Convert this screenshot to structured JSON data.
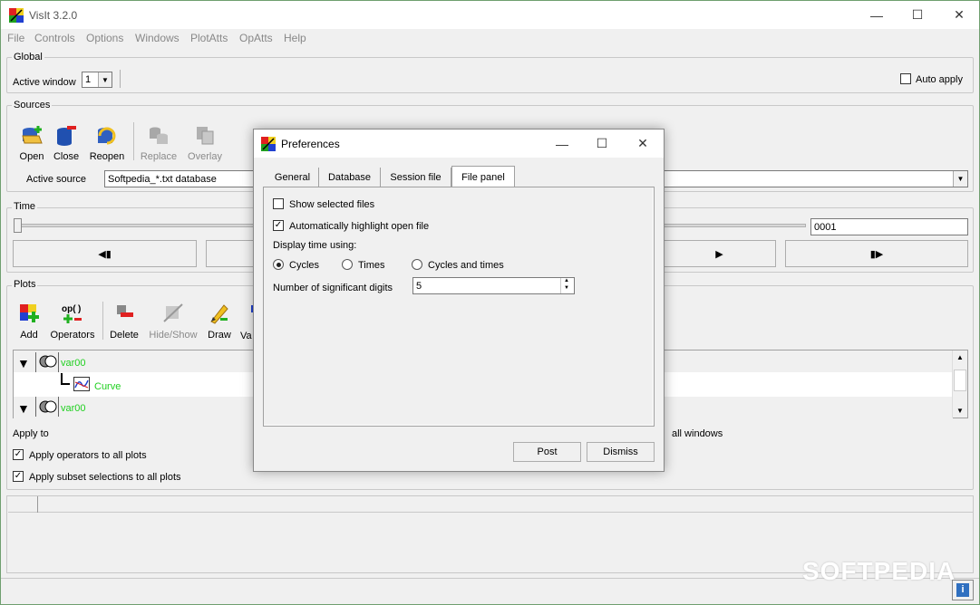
{
  "window": {
    "title": "VisIt 3.2.0",
    "minimize": "—",
    "maximize": "☐",
    "close": "✕"
  },
  "menu": [
    "File",
    "Controls",
    "Options",
    "Windows",
    "PlotAtts",
    "OpAtts",
    "Help"
  ],
  "global": {
    "label": "Global",
    "active_window_label": "Active window",
    "active_window_value": "1",
    "auto_apply": "Auto apply"
  },
  "sources": {
    "label": "Sources",
    "buttons": {
      "open": "Open",
      "close": "Close",
      "reopen": "Reopen",
      "replace": "Replace",
      "overlay": "Overlay"
    },
    "active_source_label": "Active source",
    "active_source_value": "Softpedia_*.txt database"
  },
  "time": {
    "label": "Time",
    "cycle_value": "0001",
    "prev": "◀▮",
    "play": "▶",
    "next": "▮▶"
  },
  "plots": {
    "label": "Plots",
    "buttons": {
      "add": "Add",
      "operators": "Operators",
      "delete": "Delete",
      "hideshow": "Hide/Show",
      "draw": "Draw",
      "variables": "Va"
    },
    "tree": [
      {
        "var": "var00",
        "child": "Curve"
      },
      {
        "var": "var00"
      }
    ],
    "apply_to": "Apply to",
    "all_windows": "all windows",
    "apply_operators": "Apply operators to all plots",
    "apply_subset": "Apply subset selections to all plots"
  },
  "watermark": "SOFTPEDIA",
  "dialog": {
    "title": "Preferences",
    "tabs": [
      "General",
      "Database",
      "Session file",
      "File panel"
    ],
    "active_tab": "File panel",
    "show_selected": "Show selected files",
    "auto_highlight": "Automatically highlight open file",
    "display_time_label": "Display time using:",
    "radios": [
      "Cycles",
      "Times",
      "Cycles and times"
    ],
    "selected_radio": "Cycles",
    "sig_digits_label": "Number of significant digits",
    "sig_digits_value": "5",
    "post": "Post",
    "dismiss": "Dismiss"
  },
  "colors": {
    "accent_green": "#20d020",
    "window_bg": "#f0f0f0"
  }
}
